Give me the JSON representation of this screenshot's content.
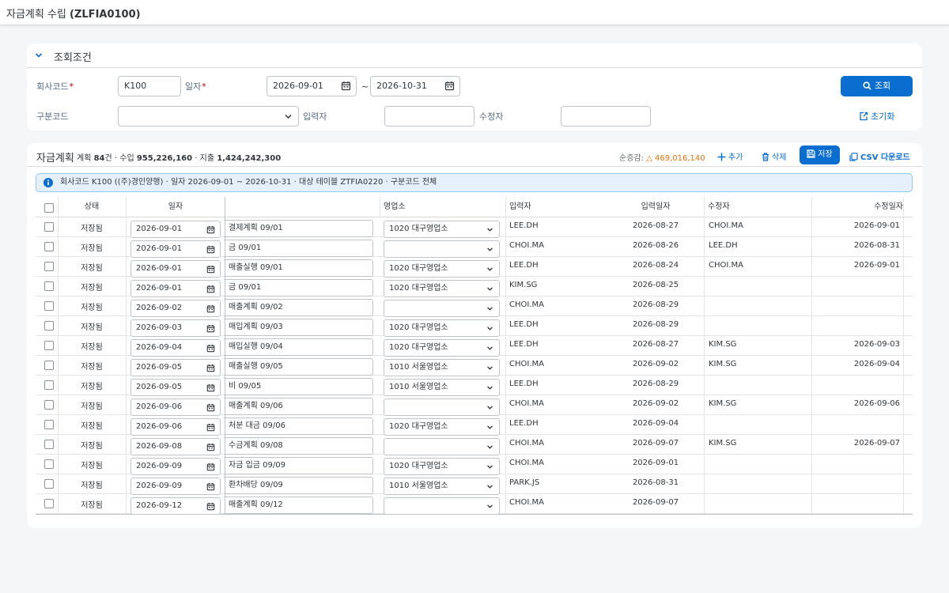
{
  "app": {
    "title_prefix": "자금계획 수립 ",
    "title_code": "(ZLFIA0100)"
  },
  "filter": {
    "title": "조회조건",
    "company_label": "회사코드",
    "company_value": "K100",
    "date_label": "일자",
    "date_from": "2026-09-01",
    "date_sep": "~",
    "date_to": "2026-10-31",
    "type_label": "구분코드",
    "type_value": "",
    "creator_label": "입력자",
    "creator_value": "",
    "modifier_label": "수정자",
    "modifier_value": "",
    "search_label": "조회",
    "reset_label": "초기화",
    "required_mark": "*"
  },
  "table": {
    "title": "자금계획",
    "summary_1": "계획 ",
    "count": "84",
    "summary_2": "건 · 수입 ",
    "income": "955,226,160",
    "summary_3": " · 지출 ",
    "expense": "1,424,242,300",
    "net_label": "순증감: ",
    "net_value": "△ 469,016,140",
    "add_label": "추가",
    "delete_label": "삭제",
    "save_label": "저장",
    "csv_label": "CSV 다운로드",
    "info": "회사코드 K100 ((주)경인양행) · 일자 2026-09-01 ~ 2026-10-31 · 대상 테이블 ZTFIA0220 · 구분코드 전체",
    "columns": {
      "status": "상태",
      "date": "일자",
      "desc": "",
      "branch": "영업소",
      "creator": "입력자",
      "created": "입력일자",
      "modifier": "수정자",
      "modified": "수정일자"
    },
    "rows": [
      {
        "status": "저장됨",
        "date": "2026-09-01",
        "desc": "결제계획 09/01",
        "branch": "1020 대구영업소",
        "creator": "LEE.DH",
        "created": "2026-08-27",
        "modifier": "CHOI.MA",
        "modified": "2026-09-01"
      },
      {
        "status": "저장됨",
        "date": "2026-09-01",
        "desc": "금 09/01",
        "branch": "",
        "creator": "CHOI.MA",
        "created": "2026-08-26",
        "modifier": "LEE.DH",
        "modified": "2026-08-31"
      },
      {
        "status": "저장됨",
        "date": "2026-09-01",
        "desc": "매출실행 09/01",
        "branch": "1020 대구영업소",
        "creator": "LEE.DH",
        "created": "2026-08-24",
        "modifier": "CHOI.MA",
        "modified": "2026-09-01"
      },
      {
        "status": "저장됨",
        "date": "2026-09-01",
        "desc": "금 09/01",
        "branch": "1020 대구영업소",
        "creator": "KIM.SG",
        "created": "2026-08-25",
        "modifier": "",
        "modified": ""
      },
      {
        "status": "저장됨",
        "date": "2026-09-02",
        "desc": "매출계획 09/02",
        "branch": "",
        "creator": "CHOI.MA",
        "created": "2026-08-29",
        "modifier": "",
        "modified": ""
      },
      {
        "status": "저장됨",
        "date": "2026-09-03",
        "desc": "매입계획 09/03",
        "branch": "1020 대구영업소",
        "creator": "LEE.DH",
        "created": "2026-08-29",
        "modifier": "",
        "modified": ""
      },
      {
        "status": "저장됨",
        "date": "2026-09-04",
        "desc": "매입실행 09/04",
        "branch": "1020 대구영업소",
        "creator": "LEE.DH",
        "created": "2026-08-27",
        "modifier": "KIM.SG",
        "modified": "2026-09-03"
      },
      {
        "status": "저장됨",
        "date": "2026-09-05",
        "desc": "매출실행 09/05",
        "branch": "1010 서울영업소",
        "creator": "CHOI.MA",
        "created": "2026-09-02",
        "modifier": "KIM.SG",
        "modified": "2026-09-04"
      },
      {
        "status": "저장됨",
        "date": "2026-09-05",
        "desc": "비 09/05",
        "branch": "1010 서울영업소",
        "creator": "LEE.DH",
        "created": "2026-08-29",
        "modifier": "",
        "modified": ""
      },
      {
        "status": "저장됨",
        "date": "2026-09-06",
        "desc": "매출계획 09/06",
        "branch": "",
        "creator": "CHOI.MA",
        "created": "2026-09-02",
        "modifier": "KIM.SG",
        "modified": "2026-09-06"
      },
      {
        "status": "저장됨",
        "date": "2026-09-06",
        "desc": "처분 대금 09/06",
        "branch": "1020 대구영업소",
        "creator": "LEE.DH",
        "created": "2026-09-04",
        "modifier": "",
        "modified": ""
      },
      {
        "status": "저장됨",
        "date": "2026-09-08",
        "desc": "수금계획 09/08",
        "branch": "",
        "creator": "CHOI.MA",
        "created": "2026-09-07",
        "modifier": "KIM.SG",
        "modified": "2026-09-07"
      },
      {
        "status": "저장됨",
        "date": "2026-09-09",
        "desc": "자금 입금 09/09",
        "branch": "1020 대구영업소",
        "creator": "CHOI.MA",
        "created": "2026-09-01",
        "modifier": "",
        "modified": ""
      },
      {
        "status": "저장됨",
        "date": "2026-09-09",
        "desc": "환차배당 09/09",
        "branch": "1010 서울영업소",
        "creator": "PARK.JS",
        "created": "2026-08-31",
        "modifier": "",
        "modified": ""
      },
      {
        "status": "저장됨",
        "date": "2026-09-12",
        "desc": "매출계획 09/12",
        "branch": "",
        "creator": "CHOI.MA",
        "created": "2026-09-07",
        "modifier": "",
        "modified": ""
      }
    ]
  },
  "colors": {
    "accent": "#0a6ed1",
    "warning": "#e9730c",
    "required": "#bb0000"
  },
  "icons": [
    "chevron-down-icon",
    "calendar-icon",
    "search-icon",
    "reset-icon",
    "plus-icon",
    "trash-icon",
    "save-icon",
    "csv-icon",
    "info-icon",
    "checkbox"
  ]
}
